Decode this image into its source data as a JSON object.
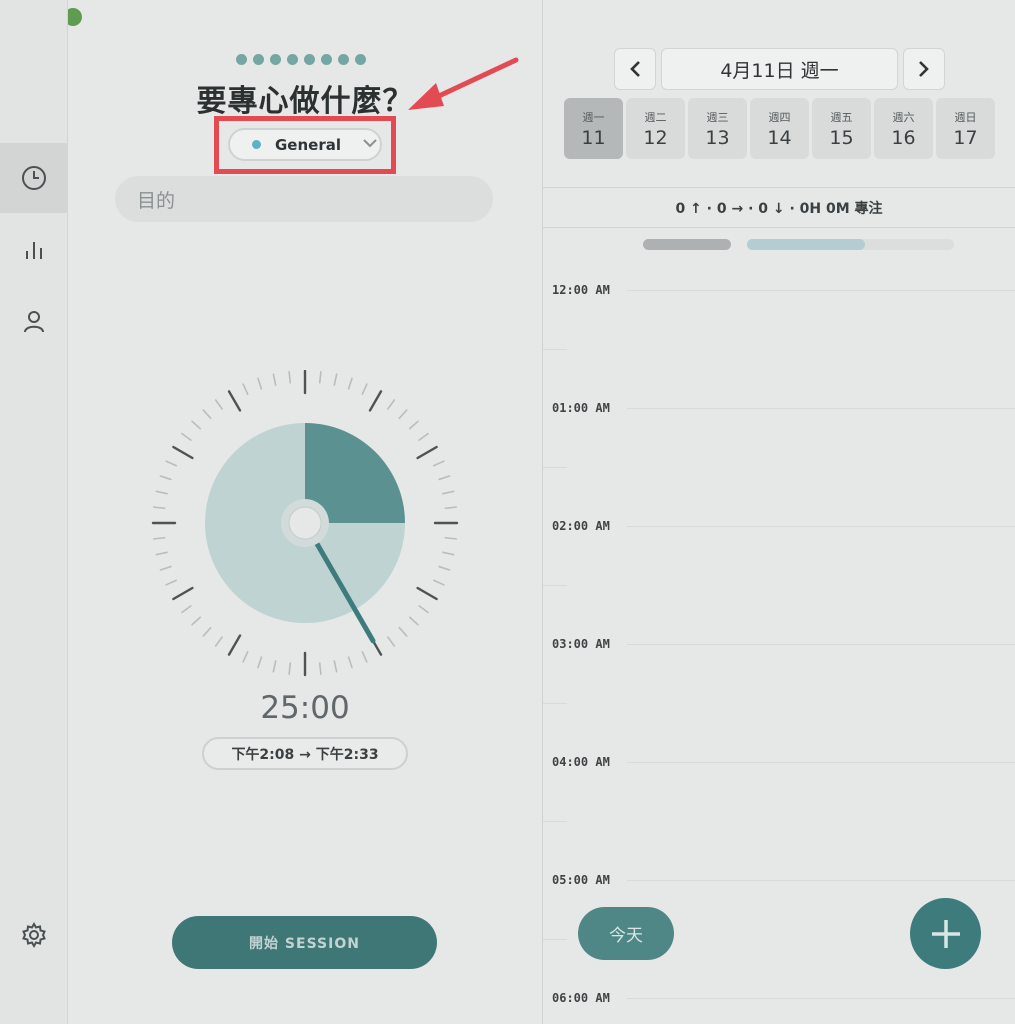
{
  "sidebar": {
    "items": [
      {
        "name": "clock-icon",
        "active": true
      },
      {
        "name": "bar-chart-icon",
        "active": false
      },
      {
        "name": "user-icon",
        "active": false
      }
    ],
    "settings_icon": "gear-icon"
  },
  "focus": {
    "question": "要專心做什麼？",
    "category": {
      "label": "General",
      "color": "#5fb1c5"
    },
    "purpose_placeholder": "目的",
    "timer": {
      "display": "25:00",
      "range": "下午2:08 → 下午2:33",
      "progress": 0.25
    },
    "start_label": "開始 SESSION"
  },
  "calendar": {
    "date_label": "4月11日 週一",
    "days": [
      {
        "name": "週一",
        "num": "11",
        "active": true
      },
      {
        "name": "週二",
        "num": "12",
        "active": false
      },
      {
        "name": "週三",
        "num": "13",
        "active": false
      },
      {
        "name": "週四",
        "num": "14",
        "active": false
      },
      {
        "name": "週五",
        "num": "15",
        "active": false
      },
      {
        "name": "週六",
        "num": "16",
        "active": false
      },
      {
        "name": "週日",
        "num": "17",
        "active": false
      }
    ],
    "stats": "0 ↑ · 0 → · 0 ↓ · 0H 0M 專注",
    "progress_fraction": 0.57,
    "hours": [
      "12:00 AM",
      "01:00 AM",
      "02:00 AM",
      "03:00 AM",
      "04:00 AM",
      "05:00 AM",
      "06:00 AM"
    ],
    "today_label": "今天"
  },
  "colors": {
    "accent": "#3f7676",
    "annotation": "#e34b52"
  }
}
